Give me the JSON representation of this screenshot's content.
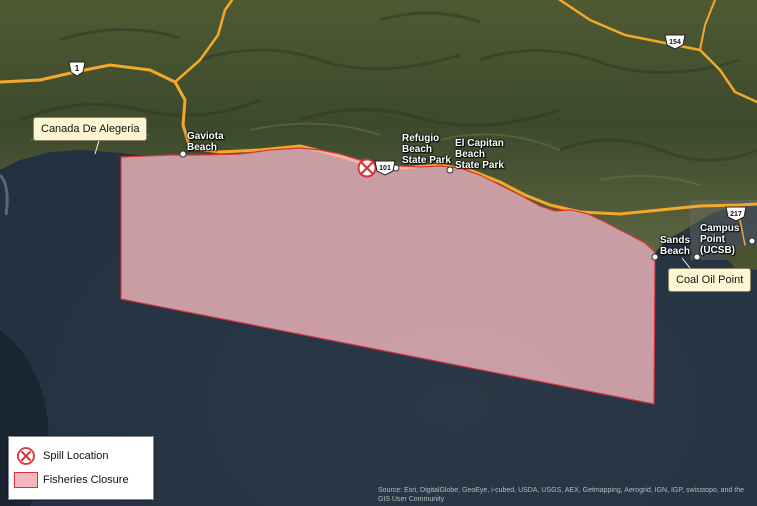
{
  "places": {
    "gaviota": "Gaviota\nBeach",
    "refugio": "Refugio\nBeach\nState Park",
    "el_capitan": "El Capitan\nBeach\nState Park",
    "sands": "Sands\nBeach",
    "campus_point": "Campus\nPoint\n(UCSB)"
  },
  "callouts": {
    "canada": "Canada De Alegeria",
    "coal_oil": "Coal Oil Point"
  },
  "highways": {
    "hw1": "1",
    "hw101": "101",
    "hw154": "154",
    "hw217": "217"
  },
  "legend": {
    "spill_label": "Spill Location",
    "closure_label": "Fisheries Closure"
  },
  "attribution": "Source: Esri, DigitalGlobe, GeoEye, i-cubed, USDA, USGS, AEX, Getmapping, Aerogrid, IGN, IGP, swisstopo, and the GIS User Community",
  "colors": {
    "closure_fill": "#f2b8bd",
    "closure_stroke": "#d8343b",
    "spill_red": "#d8343b",
    "road": "#f4a82a"
  }
}
